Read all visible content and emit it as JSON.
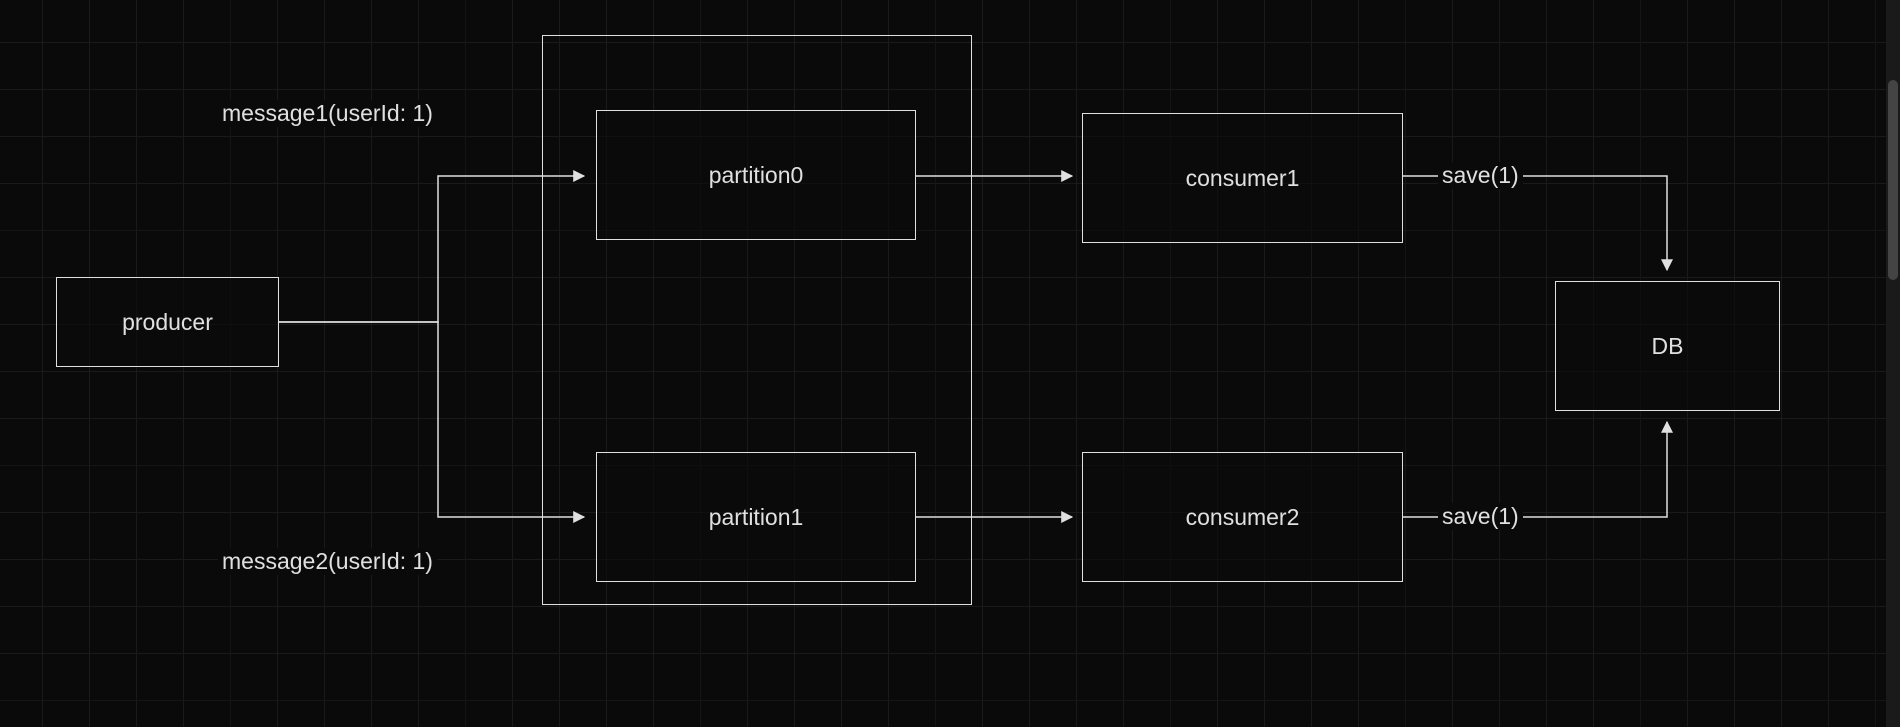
{
  "nodes": {
    "producer": "producer",
    "partition0": "partition0",
    "partition1": "partition1",
    "consumer1": "consumer1",
    "consumer2": "consumer2",
    "db": "DB"
  },
  "edges": {
    "message1": "message1(userId: 1)",
    "message2": "message2(userId: 1)",
    "save1": "save(1)",
    "save2": "save(1)"
  }
}
